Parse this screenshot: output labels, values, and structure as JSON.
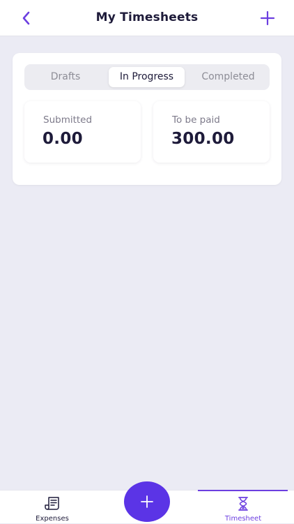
{
  "header": {
    "title": "My Timesheets",
    "back_icon": "chevron-left-icon",
    "add_icon": "plus-icon"
  },
  "tabs": [
    {
      "label": "Drafts",
      "selected": false
    },
    {
      "label": "In Progress",
      "selected": true
    },
    {
      "label": "Completed",
      "selected": false
    }
  ],
  "stats": [
    {
      "label": "Submitted",
      "value": "0.00"
    },
    {
      "label": "To be paid",
      "value": "300.00"
    }
  ],
  "bottom_nav": {
    "items": [
      {
        "label": "Expenses",
        "icon": "receipt-icon",
        "active": false
      },
      {
        "label": "Timesheet",
        "icon": "hourglass-icon",
        "active": true
      }
    ],
    "fab_icon": "plus-icon"
  },
  "colors": {
    "accent": "#6c3fe0",
    "fab": "#5b34e6",
    "background": "#ebebf4",
    "text_dark": "#1e1b3a",
    "text_muted": "#8d8d96"
  }
}
